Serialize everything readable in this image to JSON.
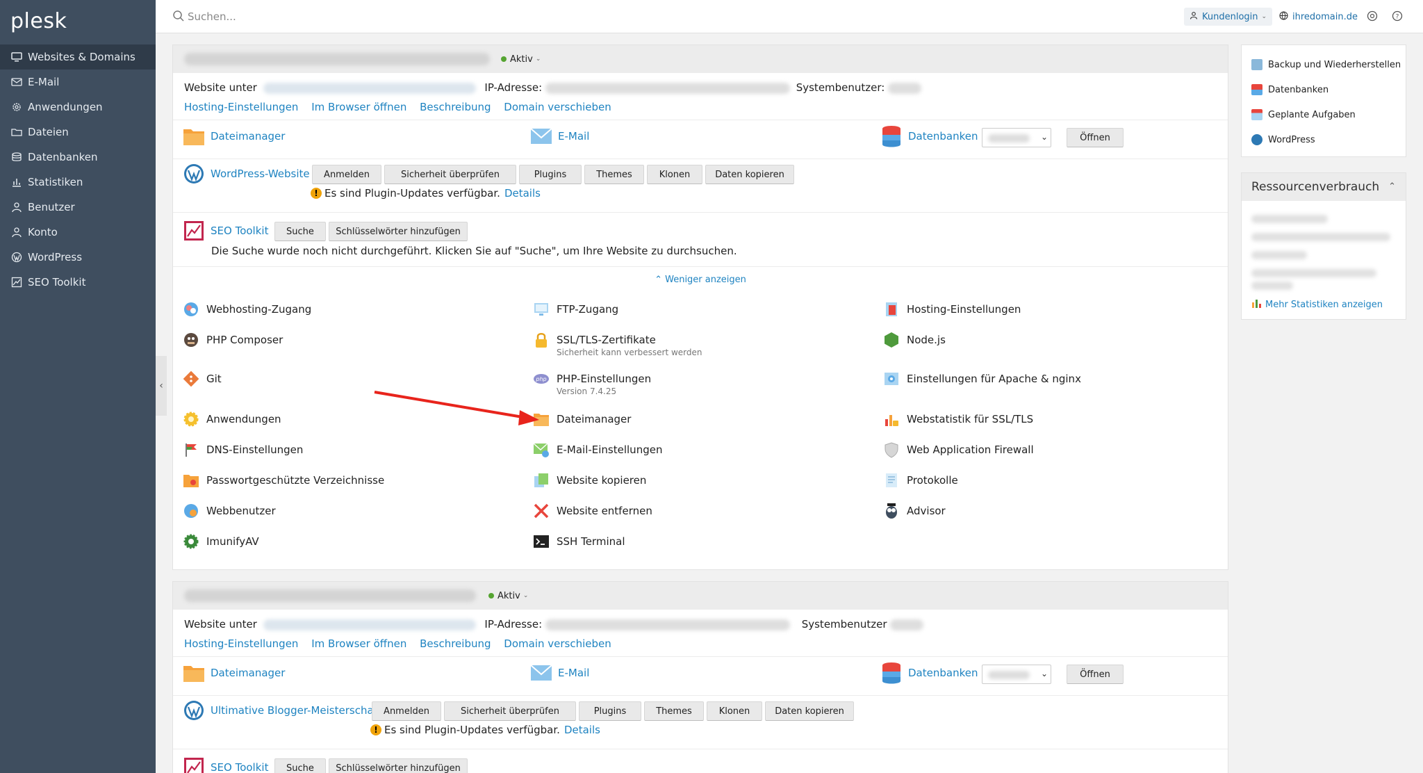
{
  "app": {
    "logo": "plesk"
  },
  "sidebar": {
    "items": [
      {
        "label": "Websites & Domains",
        "icon": "monitor-icon",
        "active": true
      },
      {
        "label": "E-Mail",
        "icon": "mail-icon"
      },
      {
        "label": "Anwendungen",
        "icon": "gear-icon"
      },
      {
        "label": "Dateien",
        "icon": "folder-icon"
      },
      {
        "label": "Datenbanken",
        "icon": "database-icon"
      },
      {
        "label": "Statistiken",
        "icon": "bar-chart-icon"
      },
      {
        "label": "Benutzer",
        "icon": "user-icon"
      },
      {
        "label": "Konto",
        "icon": "account-icon"
      },
      {
        "label": "WordPress",
        "icon": "wordpress-icon"
      },
      {
        "label": "SEO Toolkit",
        "icon": "seo-chart-icon"
      }
    ],
    "collapse_glyph": "‹"
  },
  "header": {
    "search_placeholder": "Suchen...",
    "kundenlogin": "Kundenlogin",
    "domain": "ihredomain.de"
  },
  "panels": [
    {
      "status": "Aktiv",
      "website_label": "Website unter",
      "ip_label": "IP-Adresse:",
      "sysuser_label": "Systembenutzer:",
      "links": [
        "Hosting-Einstellungen",
        "Im Browser öffnen",
        "Beschreibung",
        "Domain verschieben"
      ],
      "tools": {
        "filemanager": "Dateimanager",
        "email": "E-Mail",
        "databases": "Datenbanken",
        "open": "Öffnen"
      },
      "wordpress": {
        "label": "WordPress-Website",
        "buttons": [
          "Anmelden",
          "Sicherheit überprüfen",
          "Plugins",
          "Themes",
          "Klonen",
          "Daten kopieren"
        ],
        "warning": "Es sind Plugin-Updates verfügbar.",
        "details": "Details"
      },
      "seo": {
        "label": "SEO Toolkit",
        "buttons": [
          "Suche",
          "Schlüsselwörter hinzufügen"
        ],
        "desc": "Die Suche wurde noch nicht durchgeführt. Klicken Sie auf \"Suche\", um Ihre Website zu durchsuchen."
      },
      "less": "Weniger anzeigen",
      "grid": [
        {
          "label": "Webhosting-Zugang",
          "icon": "webhosting-icon"
        },
        {
          "label": "FTP-Zugang",
          "icon": "ftp-icon"
        },
        {
          "label": "Hosting-Einstellungen",
          "icon": "hosting-settings-icon"
        },
        {
          "label": "PHP Composer",
          "icon": "composer-icon"
        },
        {
          "label": "SSL/TLS-Zertifikate",
          "sub": "Sicherheit kann verbessert werden",
          "icon": "lock-icon"
        },
        {
          "label": "Node.js",
          "icon": "nodejs-icon"
        },
        {
          "label": "Git",
          "icon": "git-icon"
        },
        {
          "label": "PHP-Einstellungen",
          "sub": "Version 7.4.25",
          "icon": "php-icon"
        },
        {
          "label": "Einstellungen für Apache & nginx",
          "icon": "apache-nginx-icon"
        },
        {
          "label": "Anwendungen",
          "icon": "applications-icon"
        },
        {
          "label": "Dateimanager",
          "icon": "folder-icon"
        },
        {
          "label": "Webstatistik für SSL/TLS",
          "icon": "webstat-icon"
        },
        {
          "label": "DNS-Einstellungen",
          "icon": "dns-icon"
        },
        {
          "label": "E-Mail-Einstellungen",
          "icon": "mail-settings-icon"
        },
        {
          "label": "Web Application Firewall",
          "icon": "shield-icon"
        },
        {
          "label": "Passwortgeschützte Verzeichnisse",
          "icon": "protected-folder-icon"
        },
        {
          "label": "Website kopieren",
          "icon": "copy-icon"
        },
        {
          "label": "Protokolle",
          "icon": "logs-icon"
        },
        {
          "label": "Webbenutzer",
          "icon": "webuser-icon"
        },
        {
          "label": "Website entfernen",
          "icon": "remove-icon"
        },
        {
          "label": "Advisor",
          "icon": "advisor-icon"
        },
        {
          "label": "ImunifyAV",
          "icon": "imunify-icon"
        },
        {
          "label": "SSH Terminal",
          "icon": "terminal-icon"
        }
      ]
    },
    {
      "status": "Aktiv",
      "website_label": "Website unter",
      "ip_label": "IP-Adresse:",
      "sysuser_label": "Systembenutzer",
      "links": [
        "Hosting-Einstellungen",
        "Im Browser öffnen",
        "Beschreibung",
        "Domain verschieben"
      ],
      "tools": {
        "filemanager": "Dateimanager",
        "email": "E-Mail",
        "databases": "Datenbanken",
        "open": "Öffnen"
      },
      "wordpress": {
        "label": "Ultimative Blogger-Meisterschaft",
        "buttons": [
          "Anmelden",
          "Sicherheit überprüfen",
          "Plugins",
          "Themes",
          "Klonen",
          "Daten kopieren"
        ],
        "warning": "Es sind Plugin-Updates verfügbar.",
        "details": "Details"
      },
      "seo": {
        "label": "SEO Toolkit",
        "buttons": [
          "Suche",
          "Schlüsselwörter hinzufügen"
        ]
      }
    }
  ],
  "right": {
    "quick_links": [
      "Backup und Wiederherstellen",
      "Datenbanken",
      "Geplante Aufgaben",
      "WordPress"
    ],
    "resource_title": "Ressourcenverbrauch",
    "more_stats": "Mehr Statistiken anzeigen"
  },
  "colors": {
    "sidebar": "#3f4e5f",
    "link": "#1e83c1",
    "active_status": "#55a431",
    "arrow": "#e8241c"
  }
}
